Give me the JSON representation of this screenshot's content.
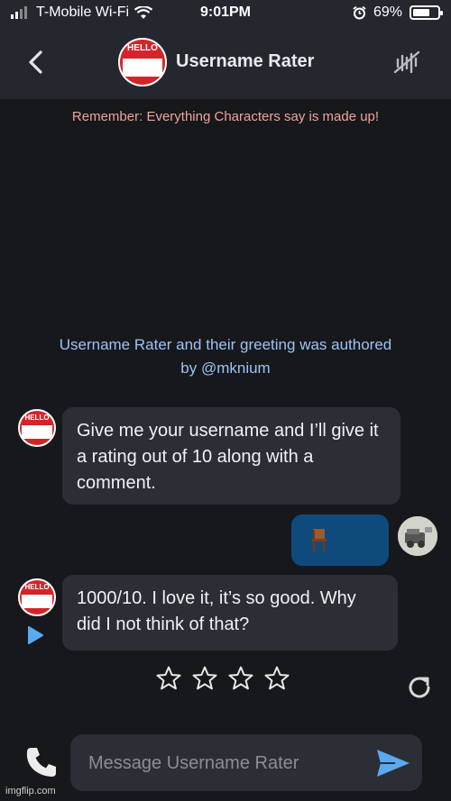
{
  "status_bar": {
    "carrier": "T-Mobile Wi-Fi",
    "time": "9:01PM",
    "battery": "69%",
    "battery_level": 0.69
  },
  "header": {
    "title": "Username Rater",
    "avatar_text": "HELLO"
  },
  "disclaimer": "Remember: Everything Characters say is made up!",
  "authored_line1": "Username Rater and their greeting was authored",
  "authored_line2": "by @mknium",
  "messages": [
    {
      "sender": "bot",
      "text": "Give me your username and I’ll give it a rating out of 10 along with a comment."
    },
    {
      "sender": "user",
      "icon": "chair-icon"
    },
    {
      "sender": "bot",
      "text": "1000/10. I love it, it’s so good. Why did I not think of that?"
    }
  ],
  "rating": {
    "stars_total": 4,
    "stars_filled": 0
  },
  "composer": {
    "placeholder": "Message Username Rater"
  },
  "watermark": "imgflip.com",
  "colors": {
    "background": "#17181c",
    "header": "#24272d",
    "bubble_bot": "#2b2e35",
    "bubble_user": "#0f4a7d",
    "disclaimer": "#f0a39a",
    "authored": "#9cc3f5",
    "accent_blue": "#5aa9f2"
  }
}
